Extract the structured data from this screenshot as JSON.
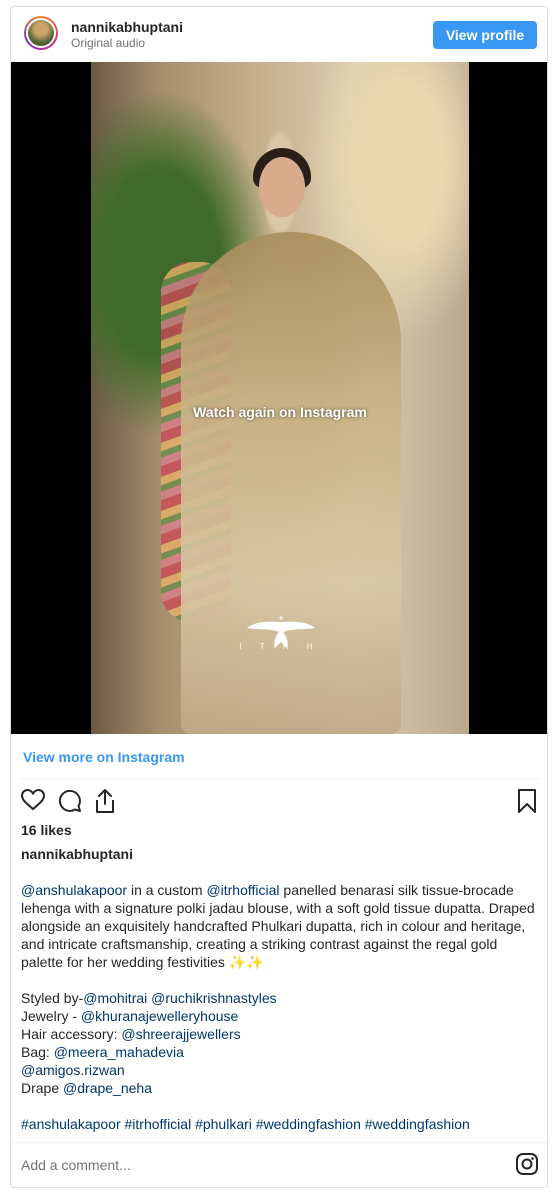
{
  "header": {
    "username": "nannikabhuptani",
    "subtitle": "Original audio",
    "view_profile": "View profile"
  },
  "media": {
    "overlay_text": "Watch again on Instagram",
    "watermark": "I T R H"
  },
  "view_more": "View more on Instagram",
  "likes": "16 likes",
  "caption_username": "nannikabhuptani",
  "caption": {
    "p1_m1": "@anshulakapoor",
    "p1_t1": " in a custom ",
    "p1_m2": "@itrhofficial",
    "p1_t2": " panelled benarasi silk tissue-brocade lehenga with a signature polki jadau blouse, with a soft gold tissue dupatta. Draped alongside an exquisitely handcrafted Phulkari dupatta, rich in colour and heritage, and intricate craftsmanship, creating a striking contrast against the regal gold palette for her wedding festivities ✨✨",
    "styled_label": "Styled by-",
    "styled_m1": "@mohitrai",
    "styled_sep": " ",
    "styled_m2": "@ruchikrishnastyles",
    "jewelry_label": "Jewelry - ",
    "jewelry_m": "@khuranajewelleryhouse",
    "hair_label": "Hair accessory: ",
    "hair_m": "@shreerajjewellers",
    "bag_label": "Bag: ",
    "bag_m": "@meera_mahadevia",
    "amigos_m": "@amigos.rizwan",
    "drape_label": "Drape ",
    "drape_m": "@drape_neha",
    "hashtags": "#anshulakapoor #itrhofficial #phulkari #weddingfashion #weddingfashion"
  },
  "comment_placeholder": "Add a comment...",
  "icons": [
    "heart-icon",
    "comment-icon",
    "share-icon",
    "bookmark-icon",
    "instagram-icon"
  ],
  "colors": {
    "link": "#00376b",
    "button": "#3897f0",
    "accent": "#3897f0"
  }
}
